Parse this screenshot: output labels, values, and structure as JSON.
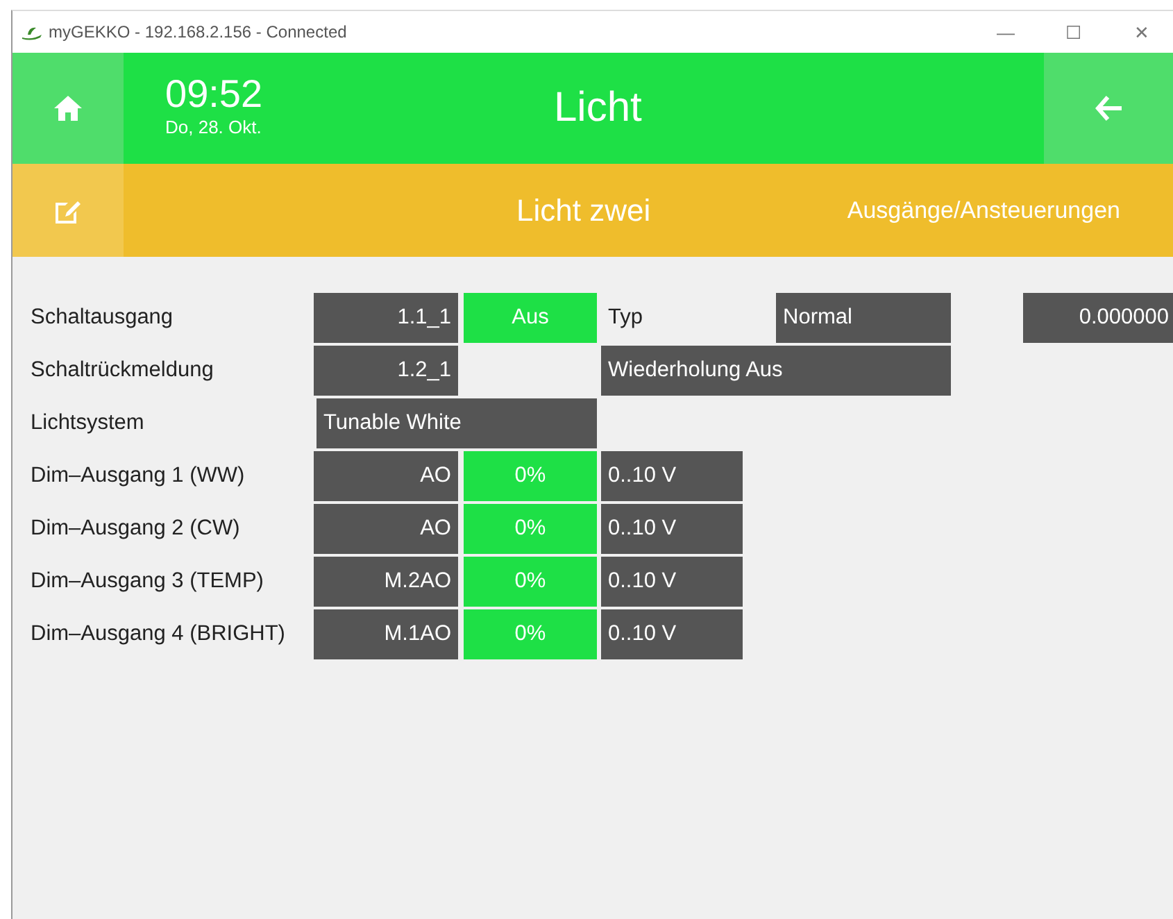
{
  "window": {
    "title": "myGEKKO - 192.168.2.156 - Connected",
    "controls": [
      "—",
      "☐",
      "✕"
    ]
  },
  "header": {
    "time": "09:52",
    "date": "Do, 28. Okt.",
    "title": "Licht"
  },
  "subheader": {
    "title": "Licht zwei",
    "section": "Ausgänge/Ansteuerungen"
  },
  "rows": [
    {
      "label": "Schaltausgang",
      "cells": [
        {
          "kind": "address",
          "text": "1.1_1"
        },
        {
          "kind": "status",
          "text": "Aus"
        },
        {
          "kind": "type_label",
          "text": "Typ"
        },
        {
          "kind": "type_value",
          "text": "Normal"
        },
        {
          "kind": "value",
          "text": "0.000000"
        }
      ]
    },
    {
      "label": "Schaltrückmeldung",
      "cells": [
        {
          "kind": "address",
          "text": "1.2_1"
        },
        {
          "kind": "wide",
          "text": "Wiederholung Aus"
        }
      ]
    },
    {
      "label": "Lichtsystem",
      "cells": [
        {
          "kind": "system",
          "text": "Tunable White"
        }
      ]
    },
    {
      "label": "Dim–Ausgang 1 (WW)",
      "cells": [
        {
          "kind": "address",
          "text": "AO"
        },
        {
          "kind": "status",
          "text": "0%"
        },
        {
          "kind": "range",
          "text": "0..10 V"
        }
      ]
    },
    {
      "label": "Dim–Ausgang 2 (CW)",
      "cells": [
        {
          "kind": "address",
          "text": "AO"
        },
        {
          "kind": "status",
          "text": "0%"
        },
        {
          "kind": "range",
          "text": "0..10 V"
        }
      ]
    },
    {
      "label": "Dim–Ausgang 3 (TEMP)",
      "cells": [
        {
          "kind": "address",
          "text": "M.2AO"
        },
        {
          "kind": "status",
          "text": "0%"
        },
        {
          "kind": "range",
          "text": "0..10 V"
        }
      ]
    },
    {
      "label": "Dim–Ausgang 4 (BRIGHT)",
      "cells": [
        {
          "kind": "address",
          "text": "M.1AO"
        },
        {
          "kind": "status",
          "text": "0%"
        },
        {
          "kind": "range",
          "text": "0..10 V"
        }
      ]
    }
  ]
}
